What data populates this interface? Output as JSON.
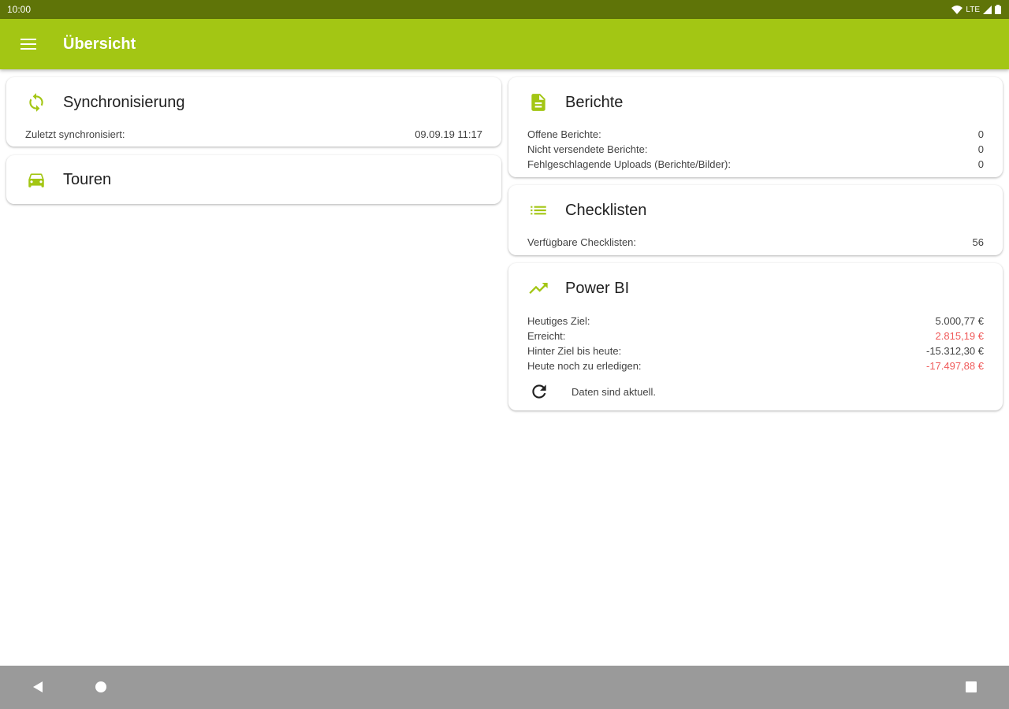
{
  "status_bar": {
    "time": "10:00",
    "network": "LTE"
  },
  "app_bar": {
    "title": "Übersicht"
  },
  "colors": {
    "accent": "#a3c614",
    "status_bar": "#5f7408",
    "negative": "#f05a5a",
    "nav_bar": "#9a9a9a"
  },
  "cards": {
    "sync": {
      "icon": "sync-icon",
      "title": "Synchronisierung",
      "rows": [
        {
          "label": "Zuletzt synchronisiert:",
          "value": "09.09.19 11:17"
        }
      ]
    },
    "tours": {
      "icon": "car-icon",
      "title": "Touren"
    },
    "reports": {
      "icon": "document-icon",
      "title": "Berichte",
      "rows": [
        {
          "label": "Offene Berichte:",
          "value": "0"
        },
        {
          "label": "Nicht versendete Berichte:",
          "value": "0"
        },
        {
          "label": "Fehlgeschlagende Uploads (Berichte/Bilder):",
          "value": "0"
        }
      ]
    },
    "checklists": {
      "icon": "list-icon",
      "title": "Checklisten",
      "rows": [
        {
          "label": "Verfügbare Checklisten:",
          "value": "56"
        }
      ]
    },
    "powerbi": {
      "icon": "trending-up-icon",
      "title": "Power BI",
      "rows": [
        {
          "label": "Heutiges Ziel:",
          "value": "5.000,77 €"
        },
        {
          "label": "Erreicht:",
          "value": "2.815,19 €"
        },
        {
          "label": "Hinter Ziel bis heute:",
          "value": "-15.312,30 €"
        },
        {
          "label": "Heute noch zu erledigen:",
          "value": "-17.497,88 €"
        }
      ],
      "refresh_icon": "refresh-icon",
      "status_text": "Daten sind aktuell."
    }
  },
  "nav_bar": {
    "back": "back-icon",
    "home": "home-icon",
    "recents": "recents-icon"
  }
}
